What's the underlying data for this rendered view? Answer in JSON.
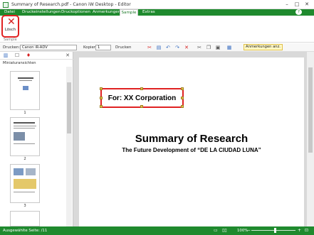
{
  "window": {
    "title": "Summary of Research.pdf - Canon iW Desktop - Editor",
    "controls": [
      "–",
      "□",
      "✕"
    ]
  },
  "ribbon": {
    "tabs": [
      {
        "label": "Datei",
        "active": false
      },
      {
        "label": "Druckeinstellungen",
        "active": false
      },
      {
        "label": "Druckoptionen",
        "active": false
      },
      {
        "label": "Anmerkungen",
        "active": false
      },
      {
        "label": "Sample",
        "active": true
      },
      {
        "label": "Extras",
        "active": false
      }
    ],
    "help": "?",
    "delete_button": {
      "label": "Lösch",
      "icon": "red-x-icon"
    },
    "group_label": "Sample"
  },
  "toolbar": {
    "printer_label": "Drucken:",
    "printer_value": "Canon iR-ADV",
    "copies_label": "Kopien",
    "copies_value": "1",
    "print_button": "Drucken",
    "annotations_button": "Anmerkungen anz."
  },
  "panel": {
    "title": "Miniaturansichten",
    "close": "✕",
    "thumbnails": [
      {
        "number": "1"
      },
      {
        "number": "2"
      },
      {
        "number": "3"
      }
    ]
  },
  "document": {
    "frame_text": "For: XX Corporation",
    "title": "Summary of Research",
    "subtitle": "The Future Development of “DE LA CIUDAD LUNA”"
  },
  "status": {
    "left_text": "Ausgewählte Seite: /11",
    "zoom": "100%",
    "zoom_level": 0.55
  },
  "colors": {
    "accent": "#1f8a2e",
    "highlight": "#e02222"
  }
}
